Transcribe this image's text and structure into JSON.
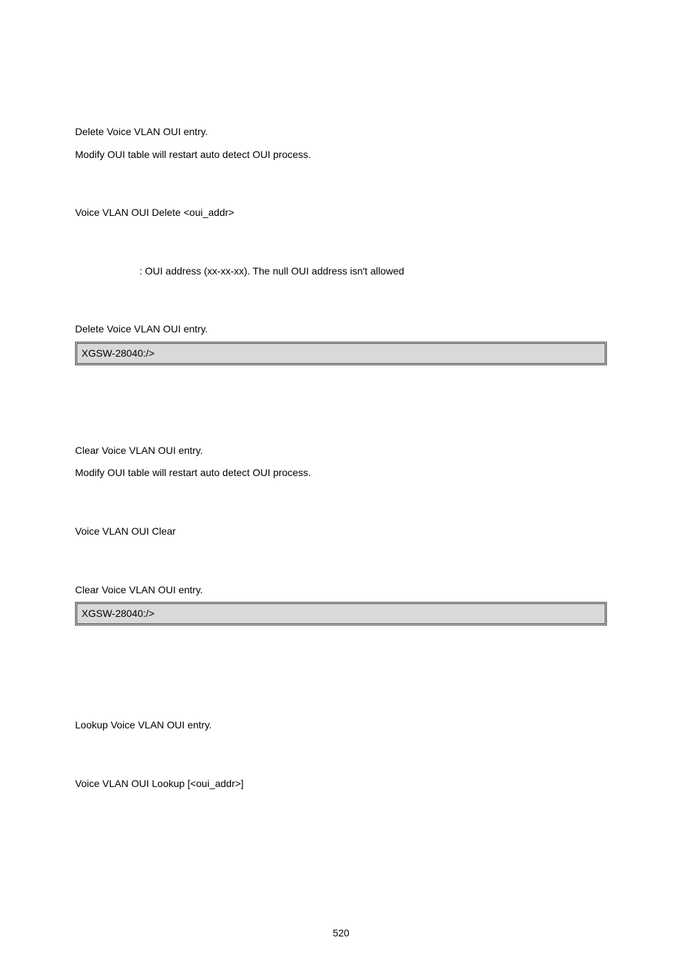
{
  "sec1": {
    "l1": "Delete Voice VLAN OUI entry.",
    "l2": "Modify OUI table will restart auto detect OUI process.",
    "syntax": "Voice VLAN OUI Delete <oui_addr>",
    "param": ": OUI address (xx-xx-xx). The null OUI address isn't allowed",
    "example_label": "Delete Voice VLAN OUI entry.",
    "code": "XGSW-28040:/>"
  },
  "sec2": {
    "l1": "Clear Voice VLAN OUI entry.",
    "l2": "Modify OUI table will restart auto detect OUI process.",
    "syntax": "Voice VLAN OUI Clear",
    "example_label": "Clear Voice VLAN OUI entry.",
    "code": "XGSW-28040:/>"
  },
  "sec3": {
    "l1": "Lookup Voice VLAN OUI entry.",
    "syntax": "Voice VLAN OUI Lookup [<oui_addr>]"
  },
  "page_number": "520"
}
